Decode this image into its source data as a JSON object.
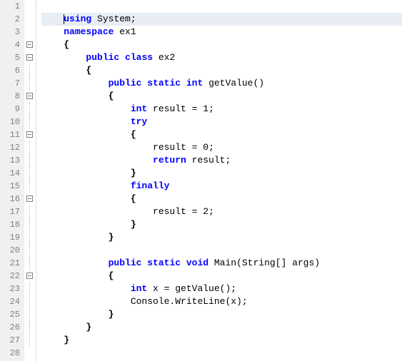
{
  "lines": {
    "l1": "",
    "l2_using": "using",
    "l2_sys": " System;",
    "l3_ns": "namespace",
    "l3_id": " ex1",
    "l4": "{",
    "l5_pub": "public",
    "l5_cls": " class",
    "l5_id": " ex2",
    "l6": "{",
    "l7_pub": "public",
    "l7_static": " static",
    "l7_int": " int",
    "l7_id": " getValue()",
    "l8": "{",
    "l9_int": "int",
    "l9_rest": " result = ",
    "l9_num": "1",
    "l9_semi": ";",
    "l10_try": "try",
    "l11": "{",
    "l12_a": "result = ",
    "l12_num": "0",
    "l12_semi": ";",
    "l13_ret": "return",
    "l13_rest": " result;",
    "l14": "}",
    "l15_fin": "finally",
    "l16": "{",
    "l17_a": "result = ",
    "l17_num": "2",
    "l17_semi": ";",
    "l18": "}",
    "l19": "}",
    "l20": "",
    "l21_pub": "public",
    "l21_static": " static",
    "l21_void": " void",
    "l21_id": " Main(String[] args)",
    "l22": "{",
    "l23_int": "int",
    "l23_rest": " x = getValue();",
    "l24": "Console.WriteLine(x);",
    "l25": "}",
    "l26": "}",
    "l27": "}",
    "l28": ""
  },
  "gutter": {
    "n1": "1",
    "n2": "2",
    "n3": "3",
    "n4": "4",
    "n5": "5",
    "n6": "6",
    "n7": "7",
    "n8": "8",
    "n9": "9",
    "n10": "10",
    "n11": "11",
    "n12": "12",
    "n13": "13",
    "n14": "14",
    "n15": "15",
    "n16": "16",
    "n17": "17",
    "n18": "18",
    "n19": "19",
    "n20": "20",
    "n21": "21",
    "n22": "22",
    "n23": "23",
    "n24": "24",
    "n25": "25",
    "n26": "26",
    "n27": "27",
    "n28": "28"
  }
}
